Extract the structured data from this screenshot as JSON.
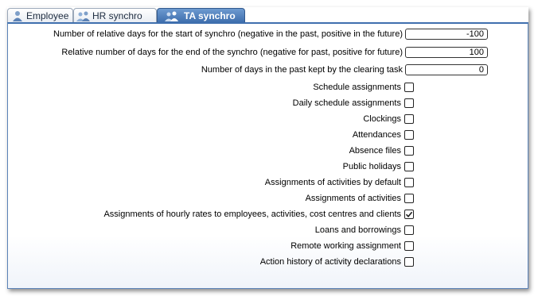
{
  "tabs": [
    {
      "label": "Employee",
      "icon": "person-icon",
      "active": false
    },
    {
      "label": "HR synchro",
      "icon": "group-icon",
      "active": false
    },
    {
      "label": "TA synchro",
      "icon": "group-icon",
      "active": true
    }
  ],
  "fields": [
    {
      "label": "Number of relative days for the start of synchro (negative in the past, positive in the future)",
      "value": "-100"
    },
    {
      "label": "Relative number of days for the end of the synchro (negative for past, positive for future)",
      "value": "100"
    },
    {
      "label": "Number of days in the past kept by the clearing task",
      "value": "0"
    }
  ],
  "checkboxes": [
    {
      "label": "Schedule assignments",
      "checked": false
    },
    {
      "label": "Daily schedule assignments",
      "checked": false
    },
    {
      "label": "Clockings",
      "checked": false
    },
    {
      "label": "Attendances",
      "checked": false
    },
    {
      "label": "Absence files",
      "checked": false
    },
    {
      "label": "Public holidays",
      "checked": false
    },
    {
      "label": "Assignments of activities by default",
      "checked": false
    },
    {
      "label": "Assignments of activities",
      "checked": false
    },
    {
      "label": "Assignments of hourly rates to employees, activities, cost centres and clients",
      "checked": true
    },
    {
      "label": "Loans and borrowings",
      "checked": false
    },
    {
      "label": "Remote working assignment",
      "checked": false
    },
    {
      "label": "Action history of activity declarations",
      "checked": false
    }
  ],
  "colors": {
    "active_tab": "#3f6fae",
    "panel_border": "#5b83b8",
    "checkmark": "#222222"
  }
}
